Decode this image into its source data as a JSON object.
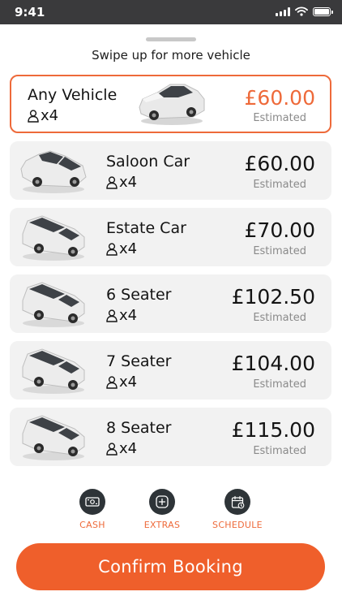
{
  "status_bar": {
    "time": "9:41"
  },
  "sheet": {
    "swipe_hint": "Swipe up for more vehicle"
  },
  "vehicles": [
    {
      "name": "Any Vehicle",
      "seats": "x4",
      "price": "£60.00",
      "estimated": "Estimated",
      "selected": true
    },
    {
      "name": "Saloon Car",
      "seats": "x4",
      "price": "£60.00",
      "estimated": "Estimated",
      "selected": false
    },
    {
      "name": "Estate Car",
      "seats": "x4",
      "price": "£70.00",
      "estimated": "Estimated",
      "selected": false
    },
    {
      "name": "6 Seater",
      "seats": "x4",
      "price": "£102.50",
      "estimated": "Estimated",
      "selected": false
    },
    {
      "name": "7 Seater",
      "seats": "x4",
      "price": "£104.00",
      "estimated": "Estimated",
      "selected": false
    },
    {
      "name": "8 Seater",
      "seats": "x4",
      "price": "£115.00",
      "estimated": "Estimated",
      "selected": false
    }
  ],
  "actions": [
    {
      "label": "CASH",
      "icon": "cash-icon"
    },
    {
      "label": "EXTRAS",
      "icon": "plus-icon"
    },
    {
      "label": "SCHEDULE",
      "icon": "calendar-icon"
    }
  ],
  "confirm": {
    "label": "Confirm Booking"
  },
  "colors": {
    "accent": "#ef5f2b",
    "card_bg": "#f2f2f2",
    "status_bar": "#3a3a3c",
    "action_icon_bg": "#2e3438"
  }
}
